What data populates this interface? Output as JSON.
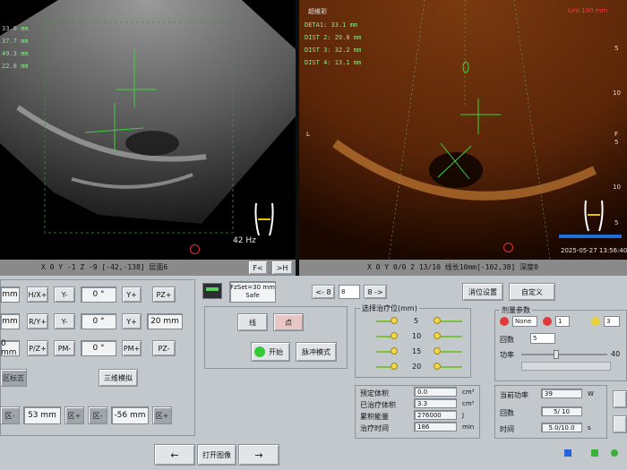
{
  "left_image": {
    "readouts": [
      "33.0 mm",
      "37.7 mm",
      "49.3 mm",
      "22.8 mm"
    ],
    "freq": "42 Hz",
    "status": "X 0   Y -1   Z -9   [-42,-138] 层面6",
    "btn_f": "F<",
    "btn_h": ">H"
  },
  "right_image": {
    "title": "超维彩",
    "top_right": "Lim:100 mm",
    "readouts": [
      "DETA1: 33.1 mm",
      "DIST 2: 29.8 mm",
      "DIST 3: 32.2 mm",
      "DIST 4: 13.1 mm"
    ],
    "marker_l": "L",
    "marker_f": "F",
    "date": "2025-05-27 13:56:40",
    "scale": [
      "5",
      "10",
      "5",
      "10",
      "5"
    ],
    "status": "X 0   Y 0/0 2   13/10  线长10mm[-102,38]   深度0"
  },
  "left_controls": {
    "unit_fields": [
      "mm",
      "mm",
      "0 mm"
    ],
    "row1": [
      "H/X+",
      "Y-",
      "0 °",
      "Y+",
      "PZ+"
    ],
    "row2": [
      "R/Y+",
      "Y-",
      "0 °",
      "Y+",
      "20 mm"
    ],
    "row3": [
      "P/Z+",
      "PM-",
      "0 °",
      "PM+",
      "PZ-"
    ],
    "label_left": "区标志",
    "three_d_button": "三维模拟",
    "bottom": [
      "区-",
      "53 mm",
      "区+",
      "区-",
      "-56 mm",
      "区+"
    ]
  },
  "center_controls": {
    "fz_set": "FzSet=30 mm",
    "fz_safe": "Safe",
    "btn_line": "线",
    "btn_point": "点",
    "btn_start": "开始",
    "btn_pulse": "脉冲模式",
    "nav_prev": "<- 8",
    "nav_sel": "8",
    "nav_next": "8 ->",
    "position_setting": "消位设置",
    "custom": "自定义",
    "select_title": "选择治疗位(mm)",
    "depths": [
      "5",
      "10",
      "15",
      "20"
    ],
    "open_image": "打开图像",
    "arrow_left": "←",
    "arrow_right": "→"
  },
  "stats": {
    "rows": [
      {
        "label": "预定体积",
        "value": "0.0",
        "unit": "cm³"
      },
      {
        "label": "已治疗体积",
        "value": "3.3",
        "unit": "cm³"
      },
      {
        "label": "累积能量",
        "value": "276000",
        "unit": "J"
      },
      {
        "label": "治疗时间",
        "value": "186",
        "unit": "min"
      }
    ]
  },
  "right_controls": {
    "section": "剂量参数",
    "none_select": "None",
    "num1": "1",
    "num2": "3",
    "times_label": "回数",
    "times_value": "5",
    "power_label": "功率",
    "power_value": "40",
    "power_level": 0.4,
    "current_power_label": "当前功率",
    "current_power_value": "39",
    "current_power_unit": "W",
    "count_label": "回数",
    "count_value": "5/ 10",
    "time_label": "时间",
    "time_value": "5.0/10.0",
    "time_unit": "s"
  }
}
